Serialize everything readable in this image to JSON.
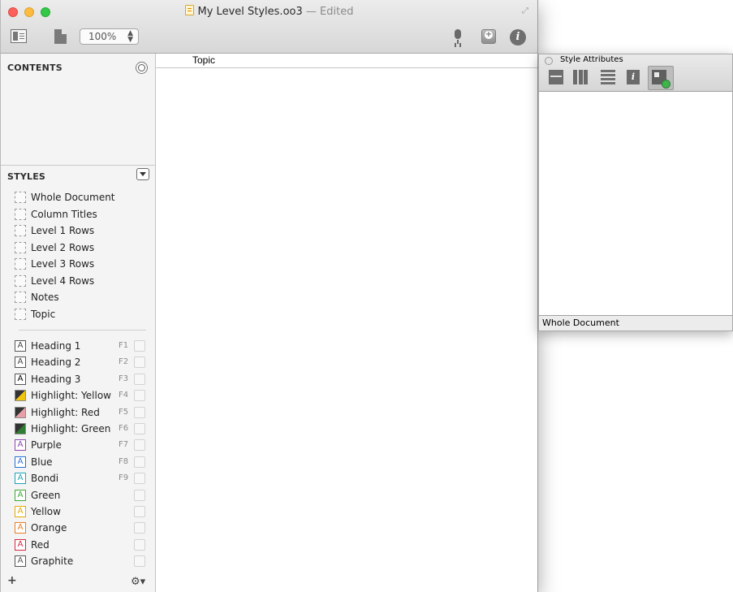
{
  "window": {
    "title": "My Level Styles.oo3",
    "separator": "—",
    "status": "Edited"
  },
  "toolbar": {
    "zoom_value": "100%",
    "icons": [
      "sidebar-toggle-icon",
      "document-icon",
      "microphone-icon",
      "add-icon",
      "info-icon"
    ]
  },
  "sidebar": {
    "contents_header": "CONTENTS",
    "styles_header": "STYLES",
    "document_styles": [
      {
        "label": "Whole Document"
      },
      {
        "label": "Column Titles"
      },
      {
        "label": "Level 1 Rows"
      },
      {
        "label": "Level 2 Rows"
      },
      {
        "label": "Level 3 Rows"
      },
      {
        "label": "Level 4 Rows"
      },
      {
        "label": "Notes"
      },
      {
        "label": "Topic"
      }
    ],
    "named_styles": [
      {
        "label": "Heading 1",
        "key": "F1",
        "color": "#444444"
      },
      {
        "label": "Heading 2",
        "key": "F2",
        "color": "#444444"
      },
      {
        "label": "Heading 3",
        "key": "F3",
        "color": "#000000"
      },
      {
        "label": "Highlight: Yellow",
        "key": "F4",
        "color": "#f1c40f"
      },
      {
        "label": "Highlight: Red",
        "key": "F5",
        "color": "#e8a0a8"
      },
      {
        "label": "Highlight: Green",
        "key": "F6",
        "color": "#2e7d32"
      },
      {
        "label": "Purple",
        "key": "F7",
        "color": "#8e44ad"
      },
      {
        "label": "Blue",
        "key": "F8",
        "color": "#2a6fd6"
      },
      {
        "label": "Bondi",
        "key": "F9",
        "color": "#1aa3b8"
      },
      {
        "label": "Green",
        "key": "",
        "color": "#3aa835"
      },
      {
        "label": "Yellow",
        "key": "",
        "color": "#e6a800"
      },
      {
        "label": "Orange",
        "key": "",
        "color": "#e67e22"
      },
      {
        "label": "Red",
        "key": "",
        "color": "#d7263d"
      },
      {
        "label": "Graphite",
        "key": "",
        "color": "#555555"
      }
    ],
    "add_label": "+",
    "gear_label": "⚙▾"
  },
  "outline": {
    "column_title": "Topic"
  },
  "inspector": {
    "title": "Style Attributes",
    "footer": "Whole Document"
  }
}
